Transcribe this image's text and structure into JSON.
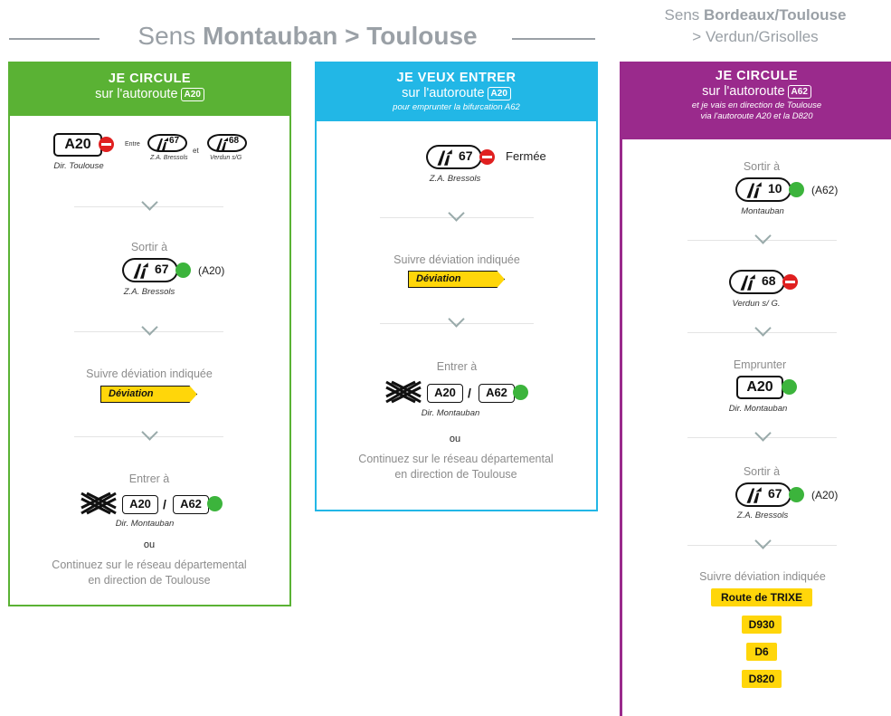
{
  "header": {
    "main_prefix": "Sens ",
    "main_bold": "Montauban > Toulouse",
    "right_line1_prefix": "Sens ",
    "right_line1_bold": "Bordeaux/Toulouse",
    "right_line2": "> Verdun/Grisolles"
  },
  "col1": {
    "title": "JE CIRCULE",
    "sub": "sur l'autoroute",
    "sub_plate": "A20",
    "s1_plate": "A20",
    "s1_cap": "Dir. Toulouse",
    "s1_between": "Entre",
    "s1_et": "et",
    "s1_exit_a": "67",
    "s1_exit_a_cap": "Z.A. Bressols",
    "s1_exit_b": "68",
    "s1_exit_b_cap": "Verdun s/G",
    "s2_label": "Sortir à",
    "s2_exit": "67",
    "s2_aside": "(A20)",
    "s2_cap": "Z.A. Bressols",
    "s3_label": "Suivre déviation indiquée",
    "s3_sign": "Déviation",
    "s4_label": "Entrer à",
    "s4_plate_a": "A20",
    "s4_plate_b": "A62",
    "s4_cap": "Dir. Montauban",
    "ou": "ou",
    "cont1": "Continuez sur le réseau départemental",
    "cont2": "en direction de Toulouse"
  },
  "col2": {
    "title": "JE VEUX ENTRER",
    "sub": "sur l'autoroute",
    "sub_plate": "A20",
    "note": "pour emprunter la bifurcation A62",
    "s1_exit": "67",
    "s1_status": "Fermée",
    "s1_cap": "Z.A. Bressols",
    "s2_label": "Suivre déviation indiquée",
    "s2_sign": "Déviation",
    "s3_label": "Entrer à",
    "s3_plate_a": "A20",
    "s3_plate_b": "A62",
    "s3_cap": "Dir. Montauban",
    "ou": "ou",
    "cont1": "Continuez sur le réseau départemental",
    "cont2": "en direction de Toulouse"
  },
  "col3": {
    "title": "JE CIRCULE",
    "sub": "sur l'autoroute",
    "sub_plate": "A62",
    "note1": "et je vais en direction de Toulouse",
    "note2": "via l'autoroute A20 et la D820",
    "s1_label": "Sortir à",
    "s1_exit": "10",
    "s1_aside": "(A62)",
    "s1_cap": "Montauban",
    "s2_exit": "68",
    "s2_cap": "Verdun s/ G.",
    "s3_label": "Emprunter",
    "s3_plate": "A20",
    "s3_cap": "Dir. Montauban",
    "s4_label": "Sortir à",
    "s4_exit": "67",
    "s4_aside": "(A20)",
    "s4_cap": "Z.A. Bressols",
    "s5_label": "Suivre déviation indiquée",
    "route1": "Route de TRIXE",
    "route2": "D930",
    "route3": "D6",
    "route4": "D820"
  },
  "colors": {
    "green": "#5ab234",
    "blue": "#22b7e6",
    "purple": "#9a2a8c",
    "red": "#e02020",
    "ok": "#3cb43c",
    "yellow": "#ffd60a"
  },
  "icons": [
    "exit-ramp-icon",
    "no-entry-icon",
    "open-status-icon",
    "interchange-icon",
    "chevron-down-icon"
  ]
}
